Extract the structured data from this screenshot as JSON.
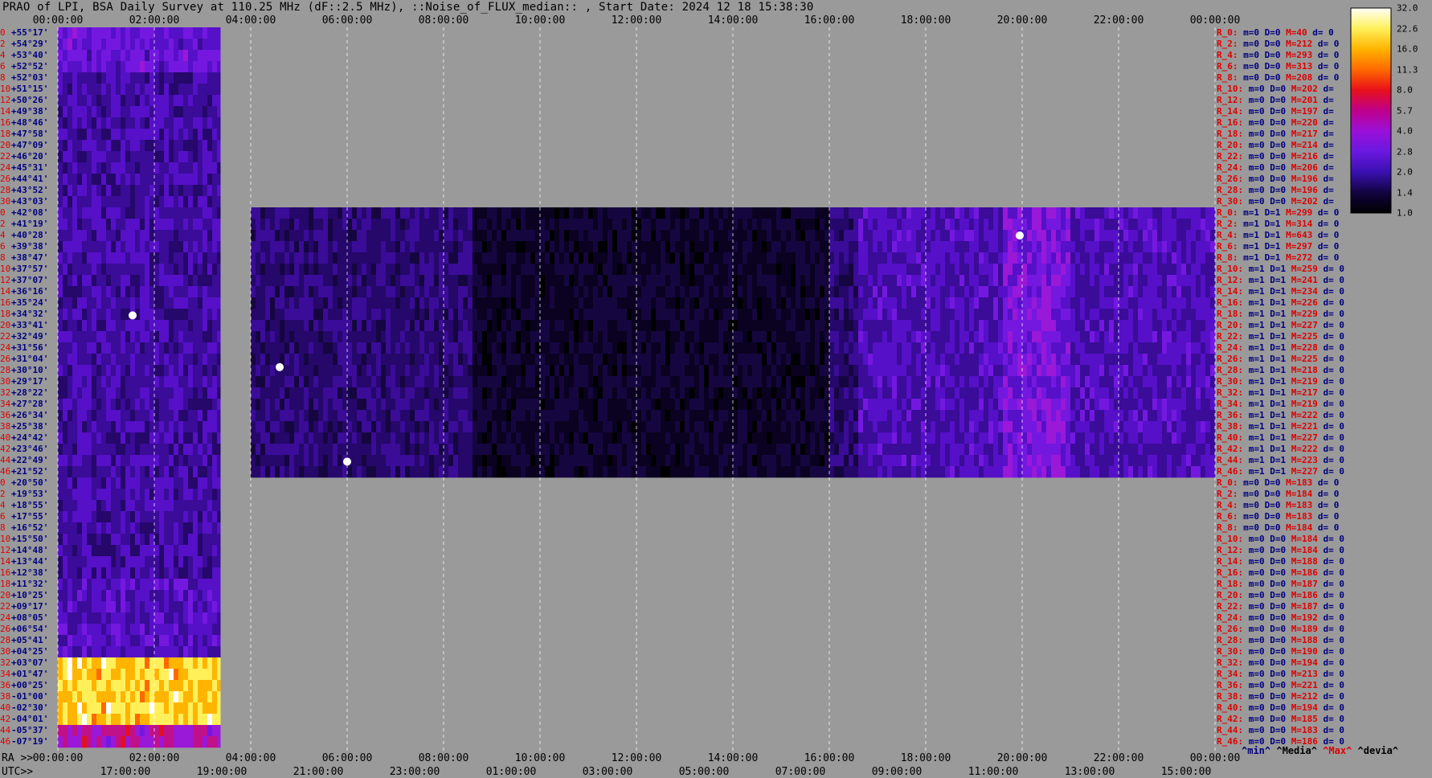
{
  "title": "PRAO of LPI, BSA Daily Survey at 110.25 MHz (dF::2.5 MHz), ::Noise_of_FLUX_median:: , Start Date: 2024 12 18 15:38:30",
  "corner_ra": "RA >>",
  "corner_utc": "UTC>>",
  "chart_data": {
    "type": "heatmap",
    "title": "PRAO of LPI, BSA Daily Survey at 110.25 MHz (dF::2.5 MHz), ::Noise_of_FLUX_median:: , Start Date: 2024 12 18 15:38:30",
    "x_axis_top_ticks": [
      "00:00:00",
      "02:00:00",
      "04:00:00",
      "06:00:00",
      "08:00:00",
      "10:00:00",
      "12:00:00",
      "14:00:00",
      "16:00:00",
      "18:00:00",
      "20:00:00",
      "22:00:00",
      "00:00:00"
    ],
    "x_axis_ra_ticks": [
      "00:00:00",
      "02:00:00",
      "04:00:00",
      "06:00:00",
      "08:00:00",
      "10:00:00",
      "12:00:00",
      "14:00:00",
      "16:00:00",
      "18:00:00",
      "20:00:00",
      "22:00:00",
      "00:00:00"
    ],
    "x_axis_utc_ticks": [
      "17:00:00",
      "19:00:00",
      "21:00:00",
      "23:00:00",
      "01:00:00",
      "03:00:00",
      "05:00:00",
      "07:00:00",
      "09:00:00",
      "11:00:00",
      "13:00:00",
      "15:00:00"
    ],
    "x_range_hours": [
      0,
      24
    ],
    "data_segments_hours": [
      [
        0,
        3.37
      ],
      [
        4.0,
        24
      ]
    ],
    "row_numbers": [
      "0",
      "2",
      "4",
      "6",
      "8",
      "10",
      "12",
      "14",
      "16",
      "18",
      "20",
      "22",
      "24",
      "26",
      "28",
      "30",
      "0",
      "2",
      "4",
      "6",
      "8",
      "10",
      "12",
      "14",
      "16",
      "18",
      "20",
      "22",
      "24",
      "26",
      "28",
      "30",
      "32",
      "34",
      "36",
      "38",
      "40",
      "42",
      "44",
      "46",
      "0",
      "2",
      "4",
      "6",
      "8",
      "10",
      "12",
      "14",
      "16",
      "18",
      "20",
      "22",
      "24",
      "26",
      "28",
      "30",
      "32",
      "34",
      "36",
      "38",
      "40",
      "42",
      "44",
      "46"
    ],
    "declinations": [
      "+55°17'",
      "+54°29'",
      "+53°40'",
      "+52°52'",
      "+52°03'",
      "+51°15'",
      "+50°26'",
      "+49°38'",
      "+48°46'",
      "+47°58'",
      "+47°09'",
      "+46°20'",
      "+45°31'",
      "+44°41'",
      "+43°52'",
      "+43°03'",
      "+42°08'",
      "+41°19'",
      "+40°28'",
      "+39°38'",
      "+38°47'",
      "+37°57'",
      "+37°07'",
      "+36°16'",
      "+35°24'",
      "+34°32'",
      "+33°41'",
      "+32°49'",
      "+31°56'",
      "+31°04'",
      "+30°10'",
      "+29°17'",
      "+28°22'",
      "+27°28'",
      "+26°34'",
      "+25°38'",
      "+24°42'",
      "+23°46'",
      "+22°49'",
      "+21°52'",
      "+20°50'",
      "+19°53'",
      "+18°55'",
      "+17°55'",
      "+16°52'",
      "+15°50'",
      "+14°48'",
      "+13°44'",
      "+12°38'",
      "+11°32'",
      "+10°25'",
      "+09°17'",
      "+08°05'",
      "+06°54'",
      "+05°41'",
      "+04°25'",
      "+03°07'",
      "+01°47'",
      "+00°25'",
      "-01°00'",
      "-02°30'",
      "-04°01'",
      "-05°37'",
      "-07°19'"
    ],
    "colorbar_ticks": [
      "32.0",
      "22.6",
      "16.0",
      "11.3",
      "8.0",
      "5.7",
      "4.0",
      "2.8",
      "2.0",
      "1.4",
      "1.0"
    ],
    "colorbar_colors": [
      "#fffff8",
      "#fff05a",
      "#ffb400",
      "#ff6a00",
      "#e8101a",
      "#c0008a",
      "#9a10d8",
      "#6a18e0",
      "#3a10b0",
      "#120440",
      "#000000"
    ],
    "stats_rows": [
      {
        "r": "R_0:",
        "m": "m=0",
        "D": "D=0",
        "M": "M=40",
        "d": "d= 0"
      },
      {
        "r": "R_2:",
        "m": "m=0",
        "D": "D=0",
        "M": "M=212",
        "d": "d= 0"
      },
      {
        "r": "R_4:",
        "m": "m=0",
        "D": "D=0",
        "M": "M=293",
        "d": "d= 0"
      },
      {
        "r": "R_6:",
        "m": "m=0",
        "D": "D=0",
        "M": "M=313",
        "d": "d= 0"
      },
      {
        "r": "R_8:",
        "m": "m=0",
        "D": "D=0",
        "M": "M=208",
        "d": "d= 0"
      },
      {
        "r": "R_10:",
        "m": "m=0",
        "D": "D=0",
        "M": "M=202",
        "d": "d="
      },
      {
        "r": "R_12:",
        "m": "m=0",
        "D": "D=0",
        "M": "M=201",
        "d": "d="
      },
      {
        "r": "R_14:",
        "m": "m=0",
        "D": "D=0",
        "M": "M=197",
        "d": "d="
      },
      {
        "r": "R_16:",
        "m": "m=0",
        "D": "D=0",
        "M": "M=220",
        "d": "d="
      },
      {
        "r": "R_18:",
        "m": "m=0",
        "D": "D=0",
        "M": "M=217",
        "d": "d="
      },
      {
        "r": "R_20:",
        "m": "m=0",
        "D": "D=0",
        "M": "M=214",
        "d": "d="
      },
      {
        "r": "R_22:",
        "m": "m=0",
        "D": "D=0",
        "M": "M=216",
        "d": "d="
      },
      {
        "r": "R_24:",
        "m": "m=0",
        "D": "D=0",
        "M": "M=206",
        "d": "d="
      },
      {
        "r": "R_26:",
        "m": "m=0",
        "D": "D=0",
        "M": "M=196",
        "d": "d="
      },
      {
        "r": "R_28:",
        "m": "m=0",
        "D": "D=0",
        "M": "M=196",
        "d": "d="
      },
      {
        "r": "R_30:",
        "m": "m=0",
        "D": "D=0",
        "M": "M=202",
        "d": "d="
      },
      {
        "r": "R_0:",
        "m": "m=1",
        "D": "D=1",
        "M": "M=299",
        "d": "d= 0"
      },
      {
        "r": "R_2:",
        "m": "m=1",
        "D": "D=1",
        "M": "M=314",
        "d": "d= 0"
      },
      {
        "r": "R_4:",
        "m": "m=1",
        "D": "D=1",
        "M": "M=643",
        "d": "d= 0"
      },
      {
        "r": "R_6:",
        "m": "m=1",
        "D": "D=1",
        "M": "M=297",
        "d": "d= 0"
      },
      {
        "r": "R_8:",
        "m": "m=1",
        "D": "D=1",
        "M": "M=272",
        "d": "d= 0"
      },
      {
        "r": "R_10:",
        "m": "m=1",
        "D": "D=1",
        "M": "M=259",
        "d": "d= 0"
      },
      {
        "r": "R_12:",
        "m": "m=1",
        "D": "D=1",
        "M": "M=241",
        "d": "d= 0"
      },
      {
        "r": "R_14:",
        "m": "m=1",
        "D": "D=1",
        "M": "M=234",
        "d": "d= 0"
      },
      {
        "r": "R_16:",
        "m": "m=1",
        "D": "D=1",
        "M": "M=226",
        "d": "d= 0"
      },
      {
        "r": "R_18:",
        "m": "m=1",
        "D": "D=1",
        "M": "M=229",
        "d": "d= 0"
      },
      {
        "r": "R_20:",
        "m": "m=1",
        "D": "D=1",
        "M": "M=227",
        "d": "d= 0"
      },
      {
        "r": "R_22:",
        "m": "m=1",
        "D": "D=1",
        "M": "M=225",
        "d": "d= 0"
      },
      {
        "r": "R_24:",
        "m": "m=1",
        "D": "D=1",
        "M": "M=228",
        "d": "d= 0"
      },
      {
        "r": "R_26:",
        "m": "m=1",
        "D": "D=1",
        "M": "M=225",
        "d": "d= 0"
      },
      {
        "r": "R_28:",
        "m": "m=1",
        "D": "D=1",
        "M": "M=218",
        "d": "d= 0"
      },
      {
        "r": "R_30:",
        "m": "m=1",
        "D": "D=1",
        "M": "M=219",
        "d": "d= 0"
      },
      {
        "r": "R_32:",
        "m": "m=1",
        "D": "D=1",
        "M": "M=217",
        "d": "d= 0"
      },
      {
        "r": "R_34:",
        "m": "m=1",
        "D": "D=1",
        "M": "M=219",
        "d": "d= 0"
      },
      {
        "r": "R_36:",
        "m": "m=1",
        "D": "D=1",
        "M": "M=222",
        "d": "d= 0"
      },
      {
        "r": "R_38:",
        "m": "m=1",
        "D": "D=1",
        "M": "M=221",
        "d": "d= 0"
      },
      {
        "r": "R_40:",
        "m": "m=1",
        "D": "D=1",
        "M": "M=227",
        "d": "d= 0"
      },
      {
        "r": "R_42:",
        "m": "m=1",
        "D": "D=1",
        "M": "M=222",
        "d": "d= 0"
      },
      {
        "r": "R_44:",
        "m": "m=1",
        "D": "D=1",
        "M": "M=223",
        "d": "d= 0"
      },
      {
        "r": "R_46:",
        "m": "m=1",
        "D": "D=1",
        "M": "M=227",
        "d": "d= 0"
      },
      {
        "r": "R_0:",
        "m": "m=0",
        "D": "D=0",
        "M": "M=183",
        "d": "d= 0"
      },
      {
        "r": "R_2:",
        "m": "m=0",
        "D": "D=0",
        "M": "M=184",
        "d": "d= 0"
      },
      {
        "r": "R_4:",
        "m": "m=0",
        "D": "D=0",
        "M": "M=183",
        "d": "d= 0"
      },
      {
        "r": "R_6:",
        "m": "m=0",
        "D": "D=0",
        "M": "M=183",
        "d": "d= 0"
      },
      {
        "r": "R_8:",
        "m": "m=0",
        "D": "D=0",
        "M": "M=184",
        "d": "d= 0"
      },
      {
        "r": "R_10:",
        "m": "m=0",
        "D": "D=0",
        "M": "M=184",
        "d": "d= 0"
      },
      {
        "r": "R_12:",
        "m": "m=0",
        "D": "D=0",
        "M": "M=184",
        "d": "d= 0"
      },
      {
        "r": "R_14:",
        "m": "m=0",
        "D": "D=0",
        "M": "M=188",
        "d": "d= 0"
      },
      {
        "r": "R_16:",
        "m": "m=0",
        "D": "D=0",
        "M": "M=186",
        "d": "d= 0"
      },
      {
        "r": "R_18:",
        "m": "m=0",
        "D": "D=0",
        "M": "M=187",
        "d": "d= 0"
      },
      {
        "r": "R_20:",
        "m": "m=0",
        "D": "D=0",
        "M": "M=186",
        "d": "d= 0"
      },
      {
        "r": "R_22:",
        "m": "m=0",
        "D": "D=0",
        "M": "M=187",
        "d": "d= 0"
      },
      {
        "r": "R_24:",
        "m": "m=0",
        "D": "D=0",
        "M": "M=192",
        "d": "d= 0"
      },
      {
        "r": "R_26:",
        "m": "m=0",
        "D": "D=0",
        "M": "M=189",
        "d": "d= 0"
      },
      {
        "r": "R_28:",
        "m": "m=0",
        "D": "D=0",
        "M": "M=188",
        "d": "d= 0"
      },
      {
        "r": "R_30:",
        "m": "m=0",
        "D": "D=0",
        "M": "M=190",
        "d": "d= 0"
      },
      {
        "r": "R_32:",
        "m": "m=0",
        "D": "D=0",
        "M": "M=194",
        "d": "d= 0"
      },
      {
        "r": "R_34:",
        "m": "m=0",
        "D": "D=0",
        "M": "M=213",
        "d": "d= 0"
      },
      {
        "r": "R_36:",
        "m": "m=0",
        "D": "D=0",
        "M": "M=221",
        "d": "d= 0"
      },
      {
        "r": "R_38:",
        "m": "m=0",
        "D": "D=0",
        "M": "M=212",
        "d": "d= 0"
      },
      {
        "r": "R_40:",
        "m": "m=0",
        "D": "D=0",
        "M": "M=194",
        "d": "d= 0"
      },
      {
        "r": "R_42:",
        "m": "m=0",
        "D": "D=0",
        "M": "M=185",
        "d": "d= 0"
      },
      {
        "r": "R_44:",
        "m": "m=0",
        "D": "D=0",
        "M": "M=183",
        "d": "d= 0"
      },
      {
        "r": "R_46:",
        "m": "m=0",
        "D": "D=0",
        "M": "M=186",
        "d": "d= 0"
      }
    ],
    "legend": [
      "^min^",
      "^Media^",
      "^Max^",
      "^devia^"
    ]
  }
}
